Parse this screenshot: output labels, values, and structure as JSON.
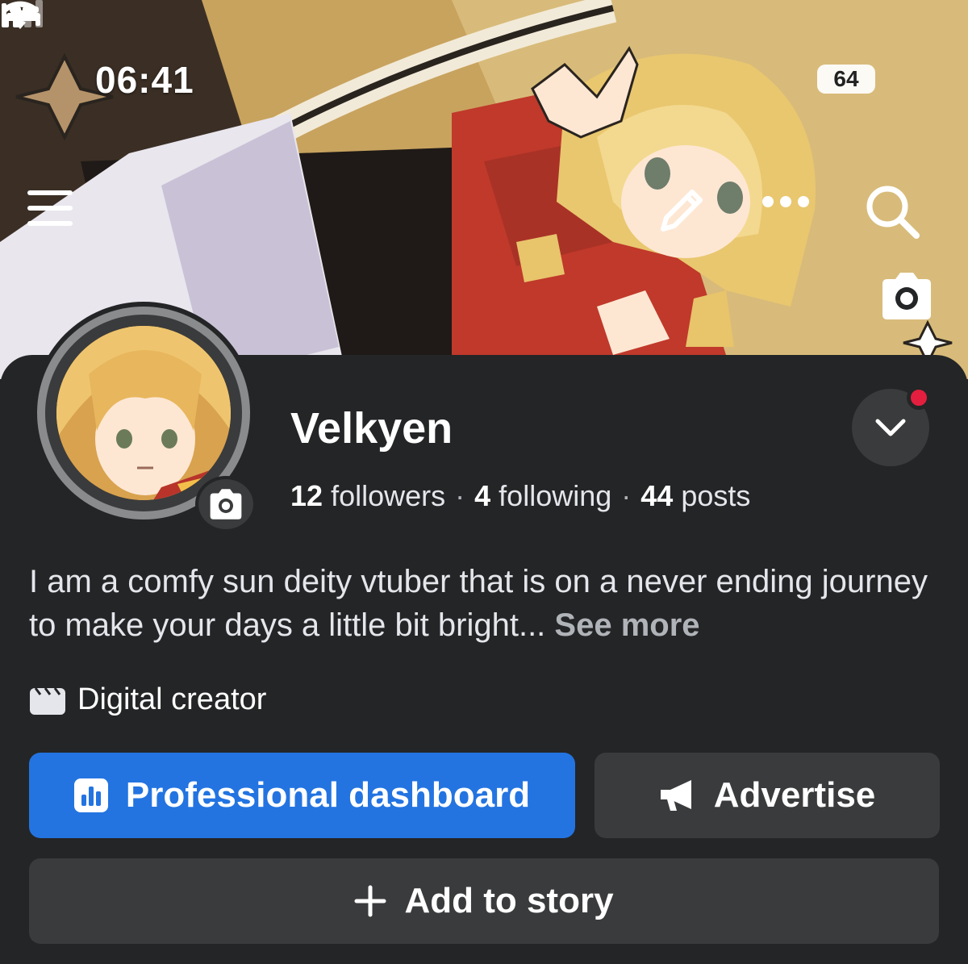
{
  "status_bar": {
    "time": "06:41",
    "battery": "64"
  },
  "profile": {
    "name": "Velkyen",
    "followers_count": "12",
    "followers_label": "followers",
    "following_count": "4",
    "following_label": "following",
    "posts_count": "44",
    "posts_label": "posts",
    "separator": "·",
    "bio": "I am a comfy sun deity vtuber that is on a never ending journey to make your days a little bit bright...",
    "see_more": "See more",
    "category": "Digital creator"
  },
  "actions": {
    "dashboard": "Professional dashboard",
    "advertise": "Advertise",
    "add_story": "Add to story"
  },
  "colors": {
    "background": "#242526",
    "primary_button": "#2374e1",
    "secondary_button": "#3a3b3c",
    "notification_dot": "#e41e3f"
  },
  "icons": [
    "bed-icon",
    "signal-icon",
    "wifi-icon",
    "menu-icon",
    "pencil-icon",
    "more-icon",
    "search-icon",
    "camera-icon",
    "chevron-down-icon",
    "clapperboard-icon",
    "bar-chart-icon",
    "megaphone-icon",
    "plus-icon"
  ]
}
